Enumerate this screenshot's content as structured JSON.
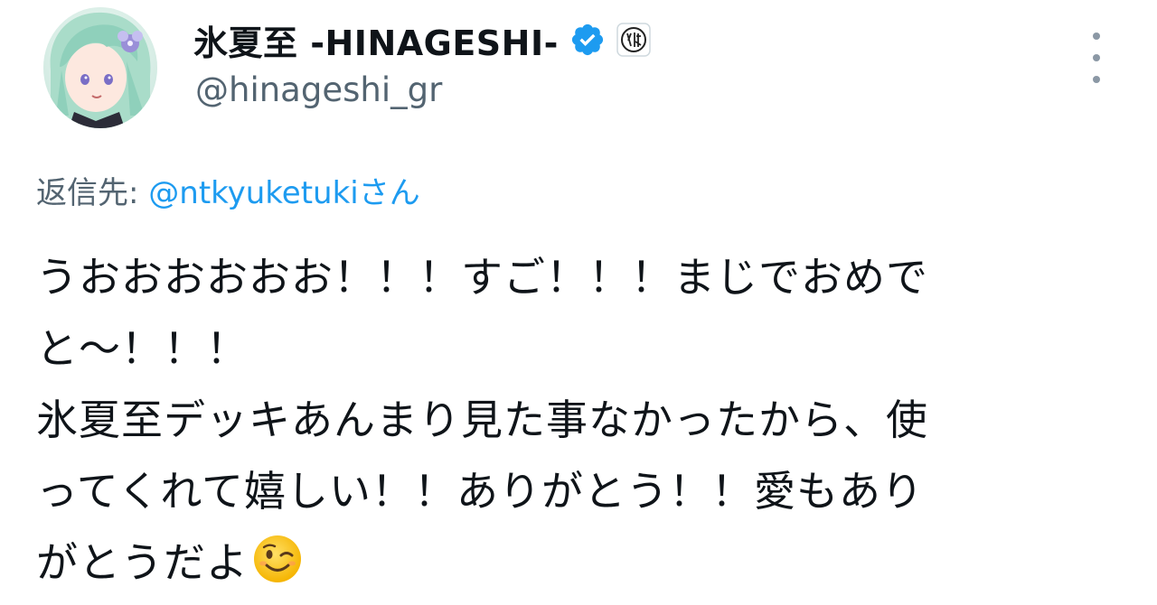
{
  "author": {
    "display_name": "氷夏至 -HINAGESHI-",
    "handle": "@hinageshi_gr",
    "verified": true,
    "avatar_icon": "avatar-anime-girl",
    "affiliate_badge_icon": "affiliate-badge-icon"
  },
  "reply": {
    "prefix": "返信先: ",
    "mention": "@ntkyuketukiさん"
  },
  "tweet": {
    "lines": [
      "うおおおおおお！！！すご！！！まじでおめで",
      "と〜！！！",
      "氷夏至デッキあんまり見た事なかったから、使",
      "ってくれて嬉しい！！ありがとう！！愛もあり",
      "がとうだよ"
    ],
    "trailing_emoji": "winking-face"
  },
  "colors": {
    "text": "#0f1419",
    "secondary": "#536471",
    "link": "#1d9bf0",
    "verified": "#1d9bf0"
  },
  "menu": {
    "more_icon": "more-vertical-icon"
  }
}
